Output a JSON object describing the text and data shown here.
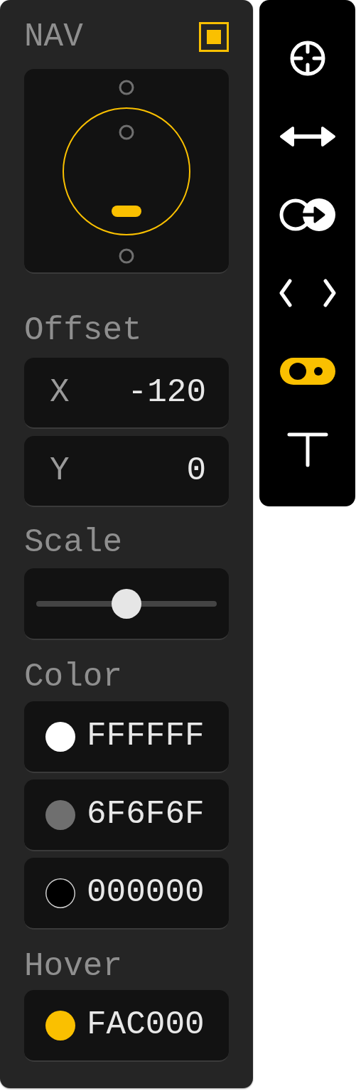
{
  "nav": {
    "title": "NAV",
    "on": true
  },
  "offset": {
    "label": "Offset",
    "fields": [
      {
        "label": "X",
        "value": "-120"
      },
      {
        "label": "Y",
        "value": "0"
      }
    ]
  },
  "scale": {
    "label": "Scale",
    "level": 0.5
  },
  "color": {
    "label": "Color",
    "swatches": [
      {
        "value": "FFFFFF",
        "color": "#ffffff"
      },
      {
        "value": "6F6F6F",
        "color": "#6f6f6f"
      },
      {
        "value": "000000",
        "color": "#000000"
      }
    ]
  },
  "hover": {
    "label": "Hover",
    "swatches": [
      {
        "value": "FAC000",
        "color": "#fac000"
      }
    ]
  },
  "toolbar": {
    "tools": [
      {
        "kind": "crosshair",
        "selected": false
      },
      {
        "kind": "double-arrow",
        "selected": false
      },
      {
        "kind": "circle-arrow",
        "selected": false
      },
      {
        "kind": "chevrons",
        "selected": false
      },
      {
        "kind": "toggle",
        "selected": true
      },
      {
        "kind": "text",
        "selected": false
      }
    ]
  }
}
